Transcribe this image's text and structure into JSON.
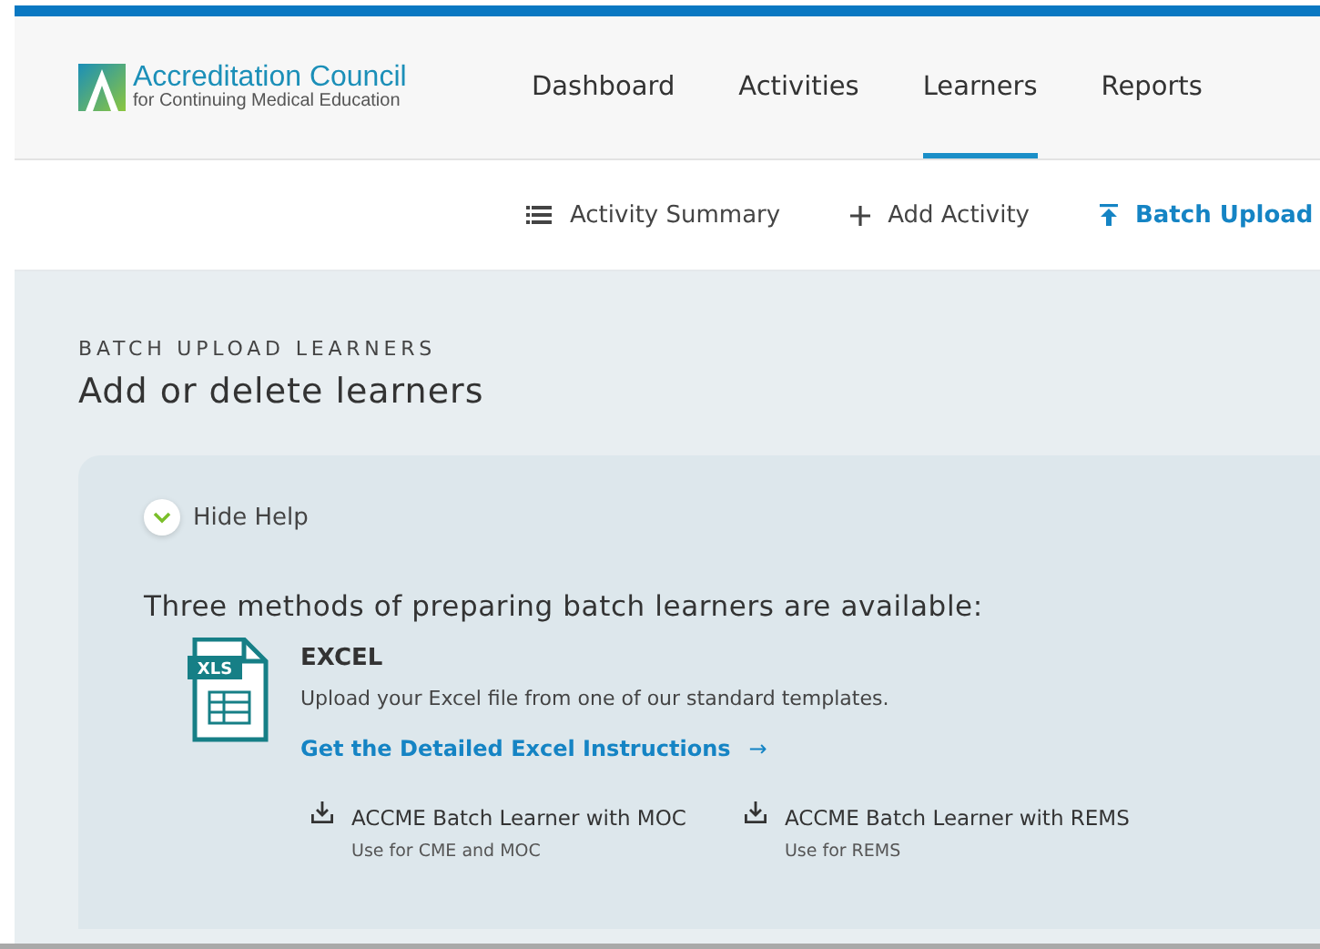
{
  "logo": {
    "name": "Accreditation Council",
    "tagline": "for Continuing Medical Education"
  },
  "nav": [
    {
      "label": "Dashboard",
      "selected": false
    },
    {
      "label": "Activities",
      "selected": false
    },
    {
      "label": "Learners",
      "selected": true
    },
    {
      "label": "Reports",
      "selected": false
    }
  ],
  "subnav": [
    {
      "label": "Activity Summary",
      "kind": "list",
      "selected": false
    },
    {
      "label": "Add Activity",
      "kind": "add",
      "selected": false
    },
    {
      "label": "Batch Upload",
      "kind": "upload",
      "selected": true
    }
  ],
  "page": {
    "eyebrow": "BATCH UPLOAD LEARNERS",
    "title": "Add or delete learners"
  },
  "help": {
    "toggle": "Hide Help",
    "expanded": true,
    "intro": "Three methods of preparing batch learners are available:",
    "method": {
      "badge": "XLS",
      "title": "EXCEL",
      "description": "Upload your Excel file from one of our standard templates.",
      "link": "Get the Detailed Excel Instructions",
      "link_arrow": "→",
      "downloads": [
        {
          "label": "ACCME Batch Learner with MOC",
          "note": "Use for CME and MOC"
        },
        {
          "label": "ACCME Batch Learner with REMS",
          "note": "Use for REMS"
        }
      ]
    }
  }
}
